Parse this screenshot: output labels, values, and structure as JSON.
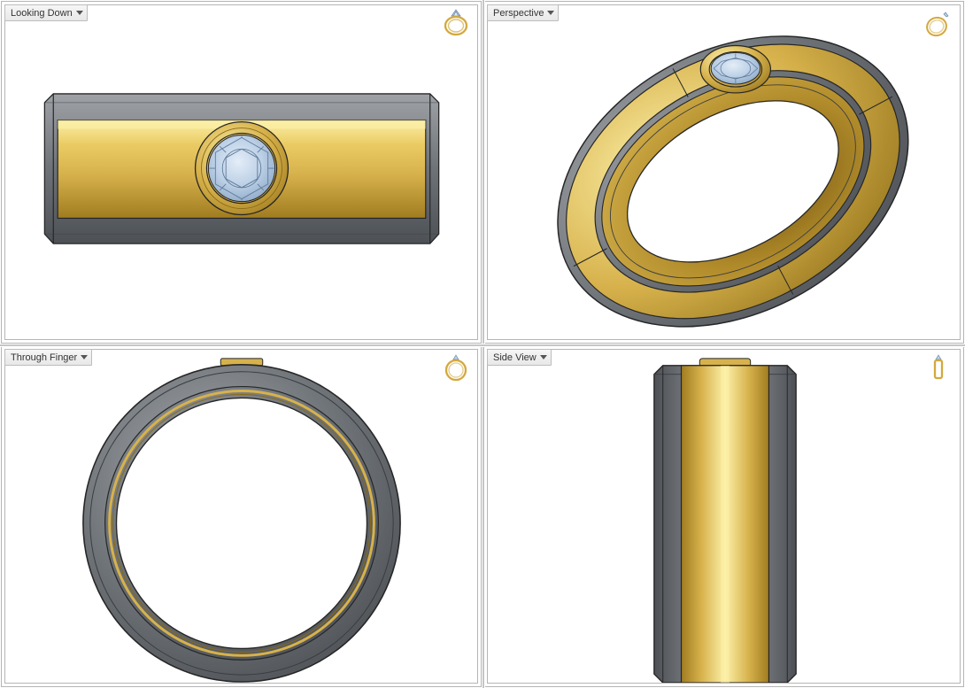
{
  "viewports": {
    "top_left": {
      "label": "Looking Down"
    },
    "top_right": {
      "label": "Perspective"
    },
    "bottom_left": {
      "label": "Through Finger"
    },
    "bottom_right": {
      "label": "Side View"
    }
  },
  "palette": {
    "gold_hi": "#fcf0a8",
    "gold_mid": "#d7b24c",
    "gold_lo": "#a07c20",
    "gold_edge": "#8a6a14",
    "steel_hi": "#9fa2a6",
    "steel_mid": "#6e7378",
    "steel_lo": "#4d5156",
    "steel_edge": "#3a3d40",
    "gem_hi": "#e4edf8",
    "gem_mid": "#bcd0e6",
    "gem_lo": "#8ea9c8",
    "gem_edge": "#5f7a99",
    "wire": "#262626"
  },
  "model": {
    "object": "ring",
    "materials": [
      "steel-edges",
      "gold-center-band",
      "round-gemstone-in-bezel"
    ]
  }
}
